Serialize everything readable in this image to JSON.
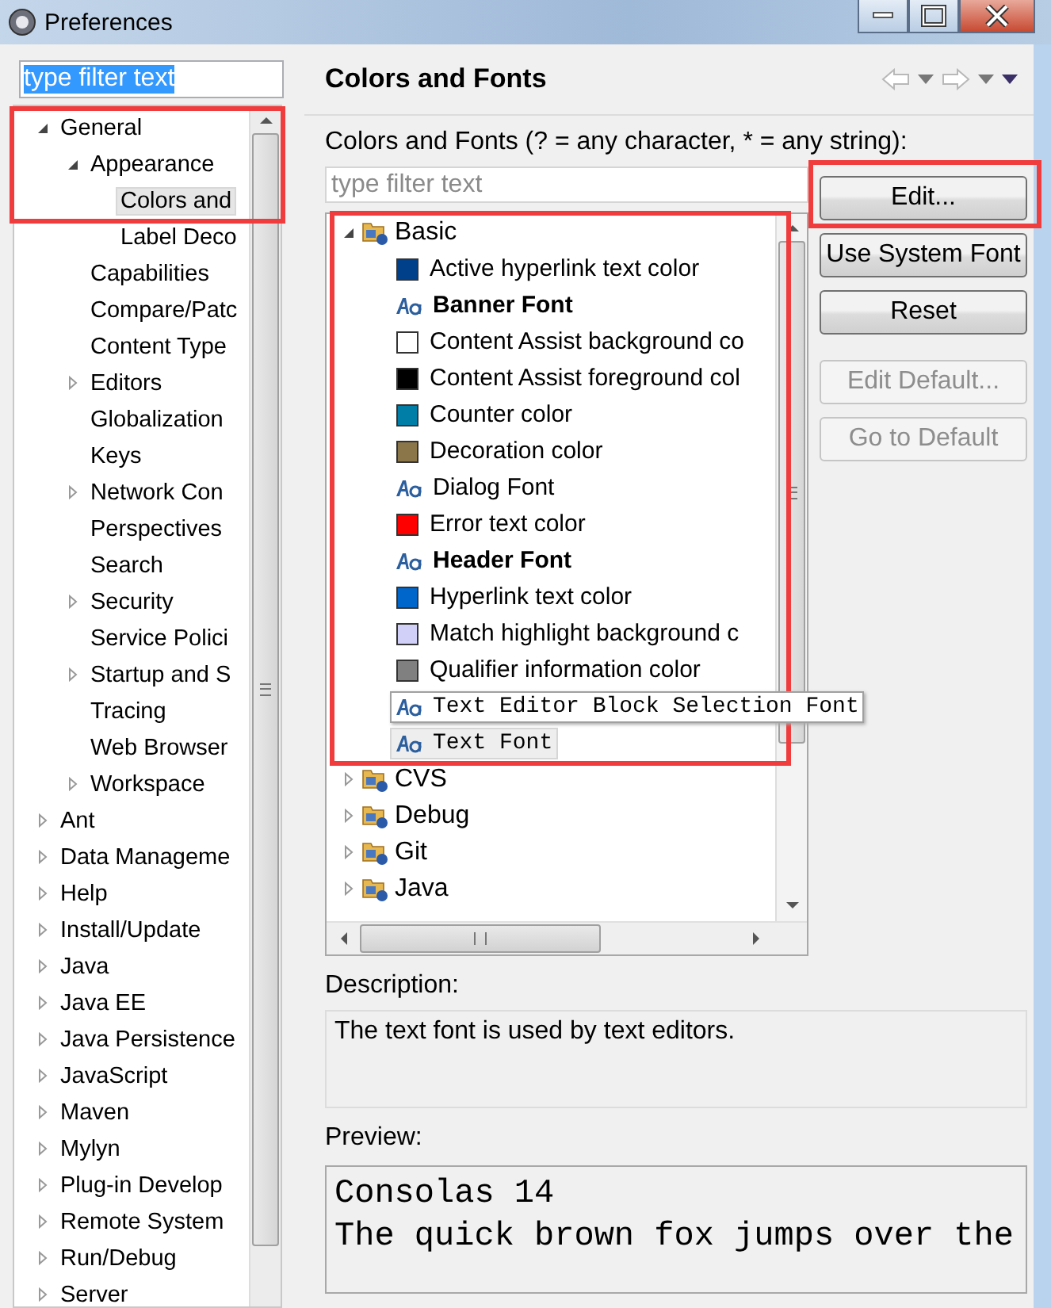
{
  "window": {
    "title": "Preferences"
  },
  "sidebar": {
    "filter": {
      "value": "type filter text",
      "selected": true
    },
    "tree": [
      {
        "label": "General",
        "expanded": true,
        "selected": false,
        "annotated": true,
        "children": [
          {
            "label": "Appearance",
            "expanded": true,
            "selected": false,
            "children": [
              {
                "label": "Colors and",
                "selected": true
              },
              {
                "label": "Label Deco",
                "selected": false
              }
            ]
          },
          {
            "label": "Capabilities",
            "selected": false
          },
          {
            "label": "Compare/Patc",
            "selected": false
          },
          {
            "label": "Content Type",
            "selected": false
          },
          {
            "label": "Editors",
            "expanded": false,
            "selected": false
          },
          {
            "label": "Globalization",
            "selected": false
          },
          {
            "label": "Keys",
            "selected": false
          },
          {
            "label": "Network Con",
            "expanded": false,
            "selected": false
          },
          {
            "label": "Perspectives",
            "selected": false
          },
          {
            "label": "Search",
            "selected": false
          },
          {
            "label": "Security",
            "expanded": false,
            "selected": false
          },
          {
            "label": "Service Polici",
            "selected": false
          },
          {
            "label": "Startup and S",
            "expanded": false,
            "selected": false
          },
          {
            "label": "Tracing",
            "selected": false
          },
          {
            "label": "Web Browser",
            "selected": false
          },
          {
            "label": "Workspace",
            "expanded": false,
            "selected": false
          }
        ]
      },
      {
        "label": "Ant",
        "expanded": false,
        "selected": false
      },
      {
        "label": "Data Manageme",
        "expanded": false,
        "selected": false
      },
      {
        "label": "Help",
        "expanded": false,
        "selected": false
      },
      {
        "label": "Install/Update",
        "expanded": false,
        "selected": false
      },
      {
        "label": "Java",
        "expanded": false,
        "selected": false
      },
      {
        "label": "Java EE",
        "expanded": false,
        "selected": false
      },
      {
        "label": "Java Persistence",
        "expanded": false,
        "selected": false
      },
      {
        "label": "JavaScript",
        "expanded": false,
        "selected": false
      },
      {
        "label": "Maven",
        "expanded": false,
        "selected": false
      },
      {
        "label": "Mylyn",
        "expanded": false,
        "selected": false
      },
      {
        "label": "Plug-in Develop",
        "expanded": false,
        "selected": false
      },
      {
        "label": "Remote System",
        "expanded": false,
        "selected": false
      },
      {
        "label": "Run/Debug",
        "expanded": false,
        "selected": false
      },
      {
        "label": "Server",
        "expanded": false,
        "selected": false
      }
    ]
  },
  "page": {
    "title": "Colors and Fonts",
    "filter_label": "Colors and Fonts (? = any character, * = any string):",
    "filter": {
      "placeholder": "type filter text"
    },
    "categories": [
      {
        "label": "Basic",
        "expanded": true,
        "annotated": true,
        "children": [
          {
            "kind": "color",
            "label": "Active hyperlink text color",
            "color": "#00408a",
            "selected": false,
            "hovered": false
          },
          {
            "kind": "bold-font",
            "label": "Banner Font",
            "selected": false,
            "hovered": false
          },
          {
            "kind": "color",
            "label": "Content Assist background co",
            "color": "#ffffff",
            "selected": false,
            "hovered": false
          },
          {
            "kind": "color",
            "label": "Content Assist foreground col",
            "color": "#000000",
            "selected": false,
            "hovered": false
          },
          {
            "kind": "color",
            "label": "Counter color",
            "color": "#007ea8",
            "selected": false,
            "hovered": false
          },
          {
            "kind": "color",
            "label": "Decoration color",
            "color": "#8a7648",
            "selected": false,
            "hovered": false
          },
          {
            "kind": "font",
            "label": "Dialog Font",
            "selected": false,
            "hovered": false
          },
          {
            "kind": "color",
            "label": "Error text color",
            "color": "#ff0000",
            "selected": false,
            "hovered": false
          },
          {
            "kind": "bold-font",
            "label": "Header Font",
            "selected": false,
            "hovered": false
          },
          {
            "kind": "color",
            "label": "Hyperlink text color",
            "color": "#0066cc",
            "selected": false,
            "hovered": false
          },
          {
            "kind": "color",
            "label": "Match highlight background c",
            "color": "#d0d0f8",
            "selected": false,
            "hovered": false
          },
          {
            "kind": "color",
            "label": "Qualifier information color",
            "color": "#808080",
            "selected": false,
            "hovered": false
          },
          {
            "kind": "mono-font",
            "label": "Text Editor Block Selection Font",
            "selected": false,
            "hovered": true
          },
          {
            "kind": "mono-font",
            "label": "Text Font",
            "selected": true,
            "hovered": false
          }
        ]
      },
      {
        "label": "CVS",
        "expanded": false
      },
      {
        "label": "Debug",
        "expanded": false
      },
      {
        "label": "Git",
        "expanded": false
      },
      {
        "label": "Java",
        "expanded": false
      }
    ],
    "buttons": [
      {
        "label": "Edit...",
        "disabled": false,
        "annotated": true
      },
      {
        "label": "Use System Font",
        "disabled": false,
        "annotated": false
      },
      {
        "label": "Reset",
        "disabled": false,
        "annotated": false
      },
      {
        "label": "Edit Default...",
        "disabled": true,
        "annotated": false
      },
      {
        "label": "Go to Default",
        "disabled": true,
        "annotated": false
      }
    ],
    "description_label": "Description:",
    "description": "The text font is used by text editors.",
    "preview_label": "Preview:",
    "preview": [
      "Consolas 14",
      "The quick brown fox jumps over the"
    ]
  }
}
